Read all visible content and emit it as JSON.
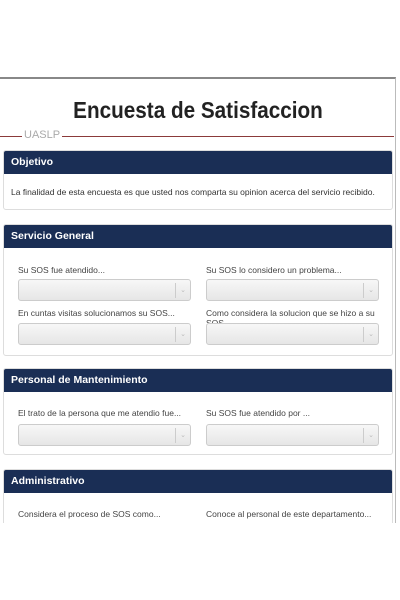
{
  "title": "Encuesta de Satisfaccion",
  "brand": "UASLP",
  "objetivo": {
    "header": "Objetivo",
    "text": "La finalidad de esta encuesta es que usted nos comparta su opinion acerca del servicio recibido."
  },
  "servicio": {
    "header": "Servicio General",
    "fields": [
      {
        "label": "Su SOS fue atendido...",
        "value": ""
      },
      {
        "label": "Su SOS lo considero un problema...",
        "value": ""
      },
      {
        "label": "En cuntas visitas solucionamos su SOS...",
        "value": ""
      },
      {
        "label": "Como considera la solucion que se hizo a su SOS...",
        "value": ""
      }
    ]
  },
  "personal": {
    "header": "Personal de Mantenimiento",
    "fields": [
      {
        "label": "El trato de la persona que me atendio fue...",
        "value": ""
      },
      {
        "label": "Su SOS fue atendido por ...",
        "value": ""
      }
    ]
  },
  "administrativo": {
    "header": "Administrativo",
    "fields": [
      {
        "label": "Considera el proceso de SOS como...",
        "value": ""
      },
      {
        "label": "Conoce al personal de este departamento...",
        "value": ""
      }
    ]
  },
  "colors": {
    "header_bg": "#1a2e55",
    "rule": "#8b3a3a"
  }
}
